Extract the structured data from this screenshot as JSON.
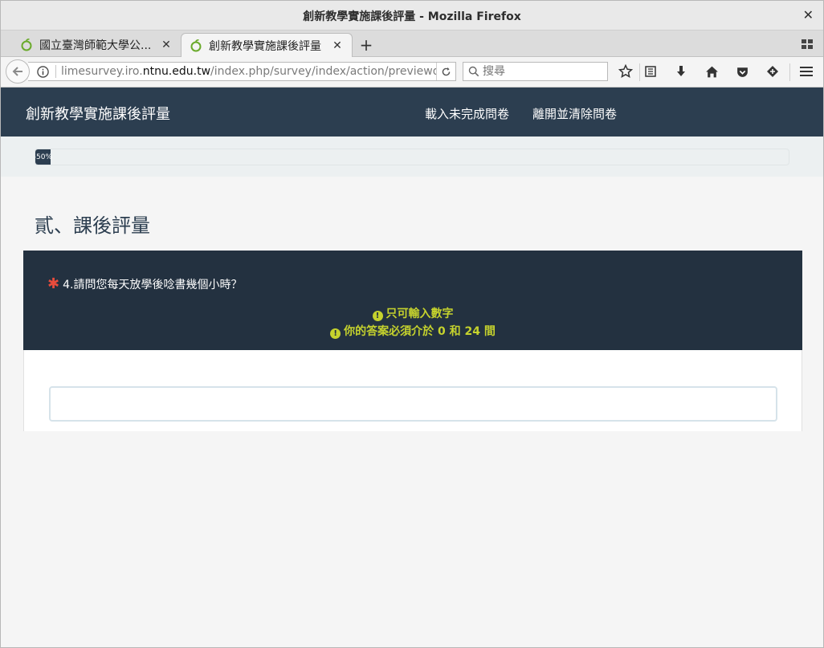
{
  "window": {
    "title": "創新教學實施課後評量 - Mozilla Firefox",
    "close_label": "✕"
  },
  "tabs": [
    {
      "label": "國立臺灣師範大學公...",
      "close_label": "✕",
      "icon": "limesurvey-favicon-icon"
    },
    {
      "label": "創新教學實施課後評量",
      "close_label": "✕",
      "icon": "limesurvey-favicon-icon"
    }
  ],
  "newtab_label": "+",
  "navbar": {
    "url_prefix": "limesurvey.iro.",
    "url_domain": "ntnu.edu.tw",
    "url_suffix": "/index.php/survey/index/action/previewque",
    "search_placeholder": "搜尋"
  },
  "site": {
    "brand": "創新教學實施課後評量",
    "link_load": "載入未完成問卷",
    "link_exit": "離開並清除問卷",
    "progress_label": "-50%",
    "progress_fraction": 0.02,
    "colors": {
      "header": "#2c3e50",
      "question_bg": "#233140",
      "tip": "#c5d22d",
      "required": "#e74c3c"
    }
  },
  "group_title": "貳、課後評量",
  "question": {
    "required_mark": "✱",
    "text": "4.請問您每天放學後唸書幾個小時？",
    "tips": [
      {
        "icon": "!",
        "text": "只可輸入數字"
      },
      {
        "icon": "!",
        "text": "你的答案必須介於 0 和 24 間"
      }
    ],
    "answer_value": ""
  }
}
